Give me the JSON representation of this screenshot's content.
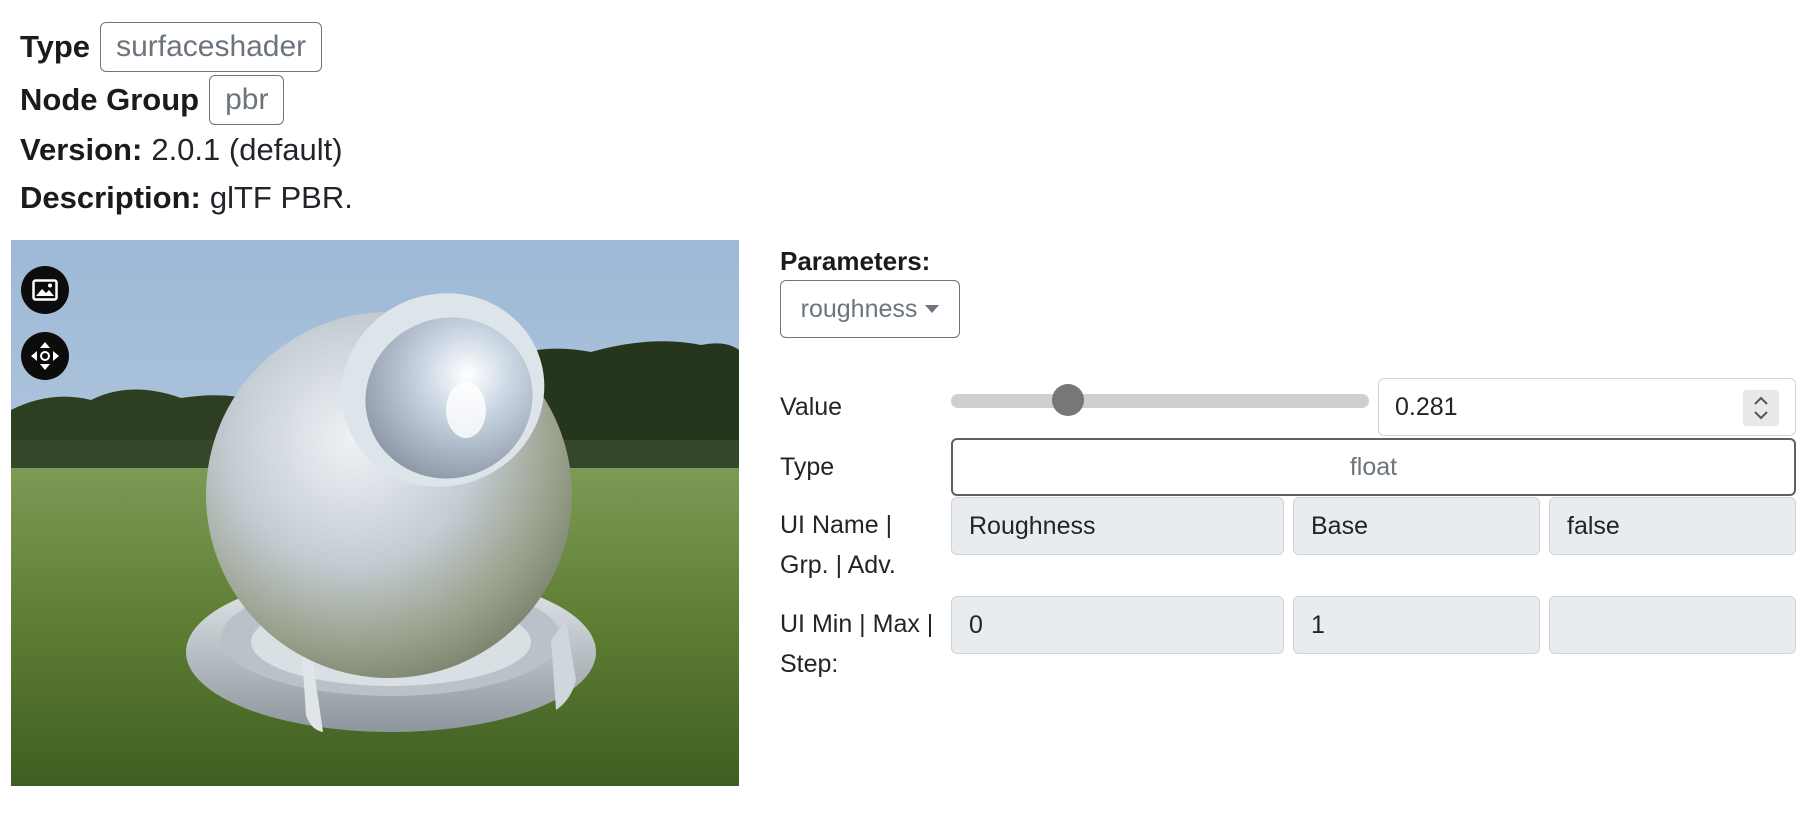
{
  "header": {
    "type_label": "Type",
    "type_value": "surfaceshader",
    "node_group_label": "Node Group",
    "node_group_value": "pbr",
    "version_label": "Version:",
    "version_value": "2.0.1 (default)",
    "description_label": "Description:",
    "description_value": "glTF PBR."
  },
  "viewer": {
    "buttons": [
      {
        "icon": "image-icon"
      },
      {
        "icon": "move-arrows-icon"
      }
    ]
  },
  "parameters": {
    "label": "Parameters:",
    "selected": "roughness",
    "value_label": "Value",
    "value": "0.281",
    "slider_fraction": 0.281,
    "type_label": "Type",
    "type_value": "float",
    "ui_name_label": "UI Name | Grp. | Adv.",
    "ui_name": "Roughness",
    "ui_group": "Base",
    "ui_advanced": "false",
    "ui_range_label": "UI Min | Max | Step:",
    "ui_min": "0",
    "ui_max": "1",
    "ui_step": ""
  },
  "colors": {
    "badge_border": "#6c757d",
    "readonly_bg": "#e9ecef",
    "slider_thumb": "#777777",
    "viewer_button_bg": "#0c0c0c"
  }
}
